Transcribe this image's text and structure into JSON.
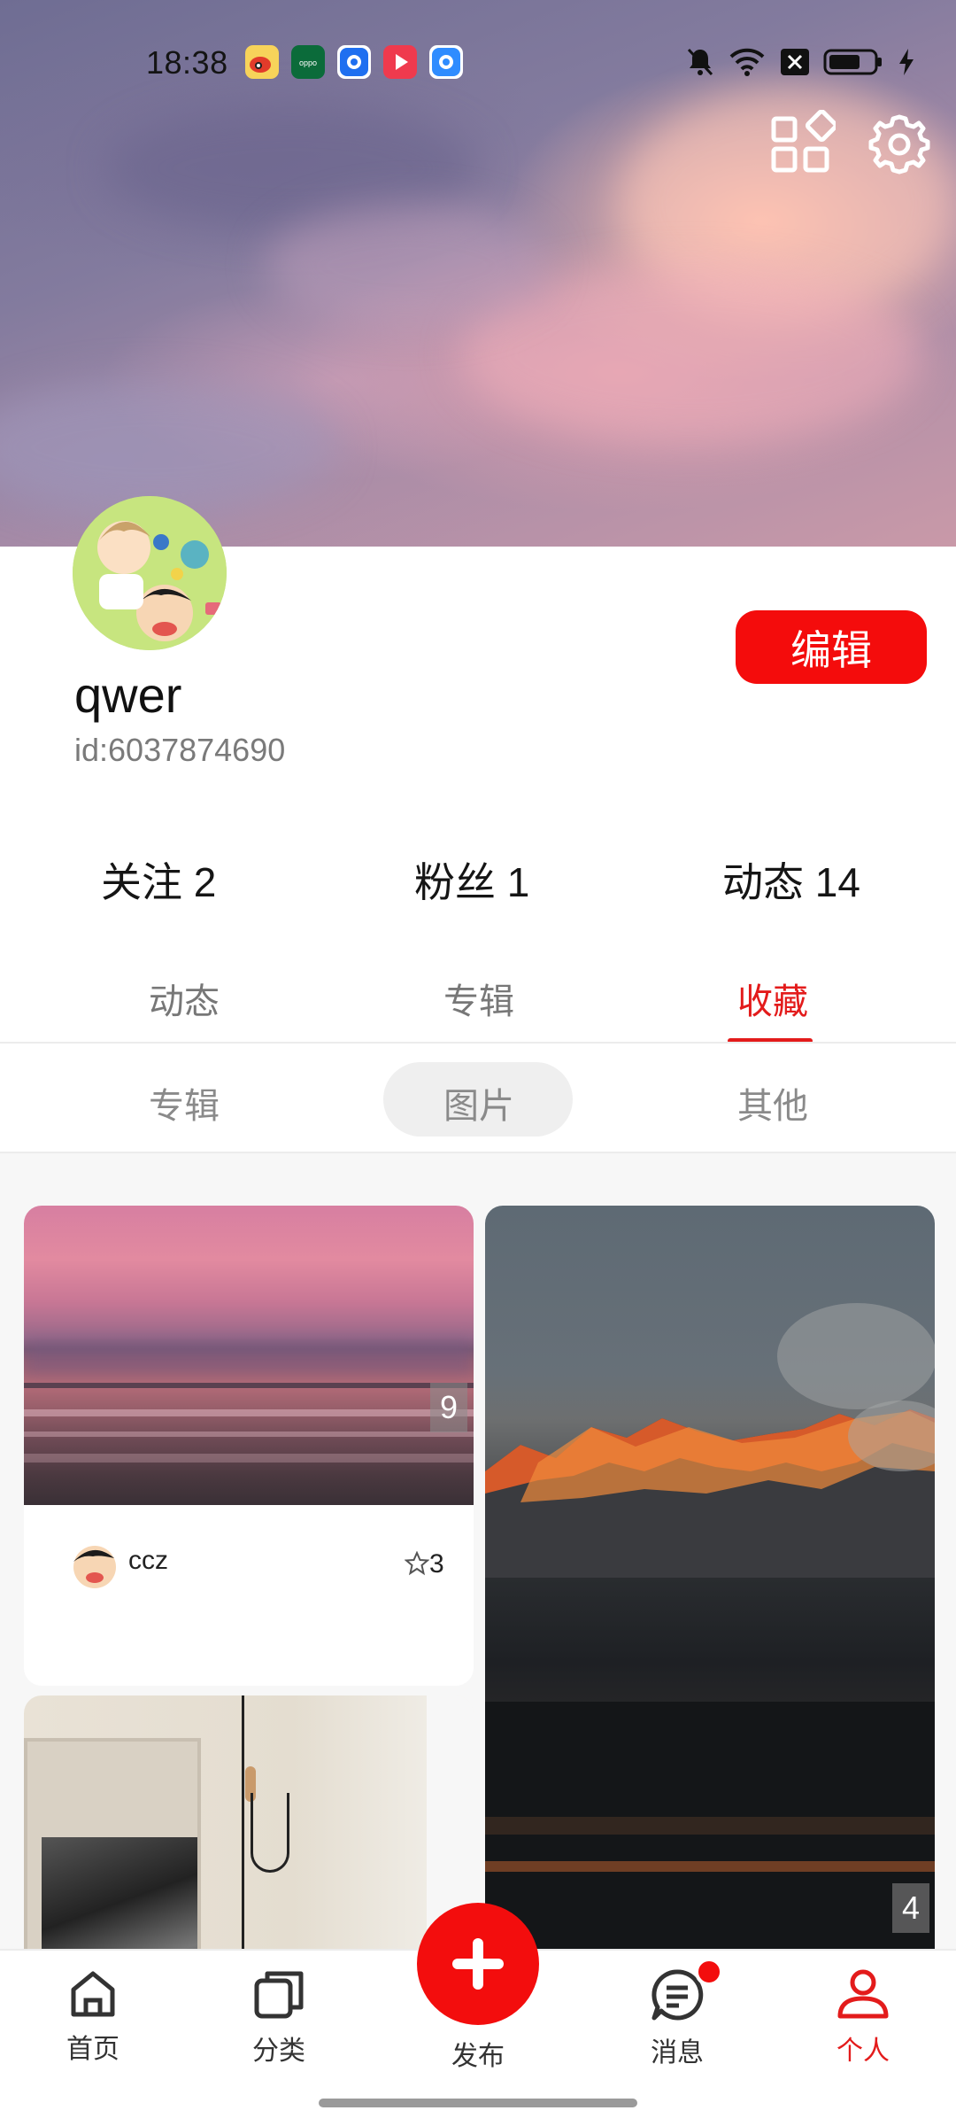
{
  "status_bar": {
    "time": "18:38",
    "apps": [
      "weibo-icon",
      "oppo-icon",
      "app-blue-icon",
      "video-red-icon",
      "app-blue2-icon"
    ]
  },
  "profile": {
    "username": "qwer",
    "id_text": "id:6037874690",
    "edit_label": "编辑"
  },
  "stats": {
    "following": "关注 2",
    "fans": "粉丝 1",
    "posts": "动态 14"
  },
  "tabs": [
    {
      "label": "动态"
    },
    {
      "label": "专辑"
    },
    {
      "label": "收藏"
    }
  ],
  "active_tab": "收藏",
  "subtabs": [
    {
      "label": "专辑"
    },
    {
      "label": "图片"
    },
    {
      "label": "其他"
    }
  ],
  "active_subtab": "图片",
  "feed": {
    "cards": [
      {
        "image_count": "9",
        "author": "ccz",
        "stars": "3"
      },
      {
        "image_count": "4"
      },
      {}
    ]
  },
  "nav": {
    "home": "首页",
    "category": "分类",
    "publish": "发布",
    "messages": "消息",
    "me": "个人"
  },
  "colors": {
    "accent": "#f30d0d",
    "tab_active": "#e31b1b"
  }
}
